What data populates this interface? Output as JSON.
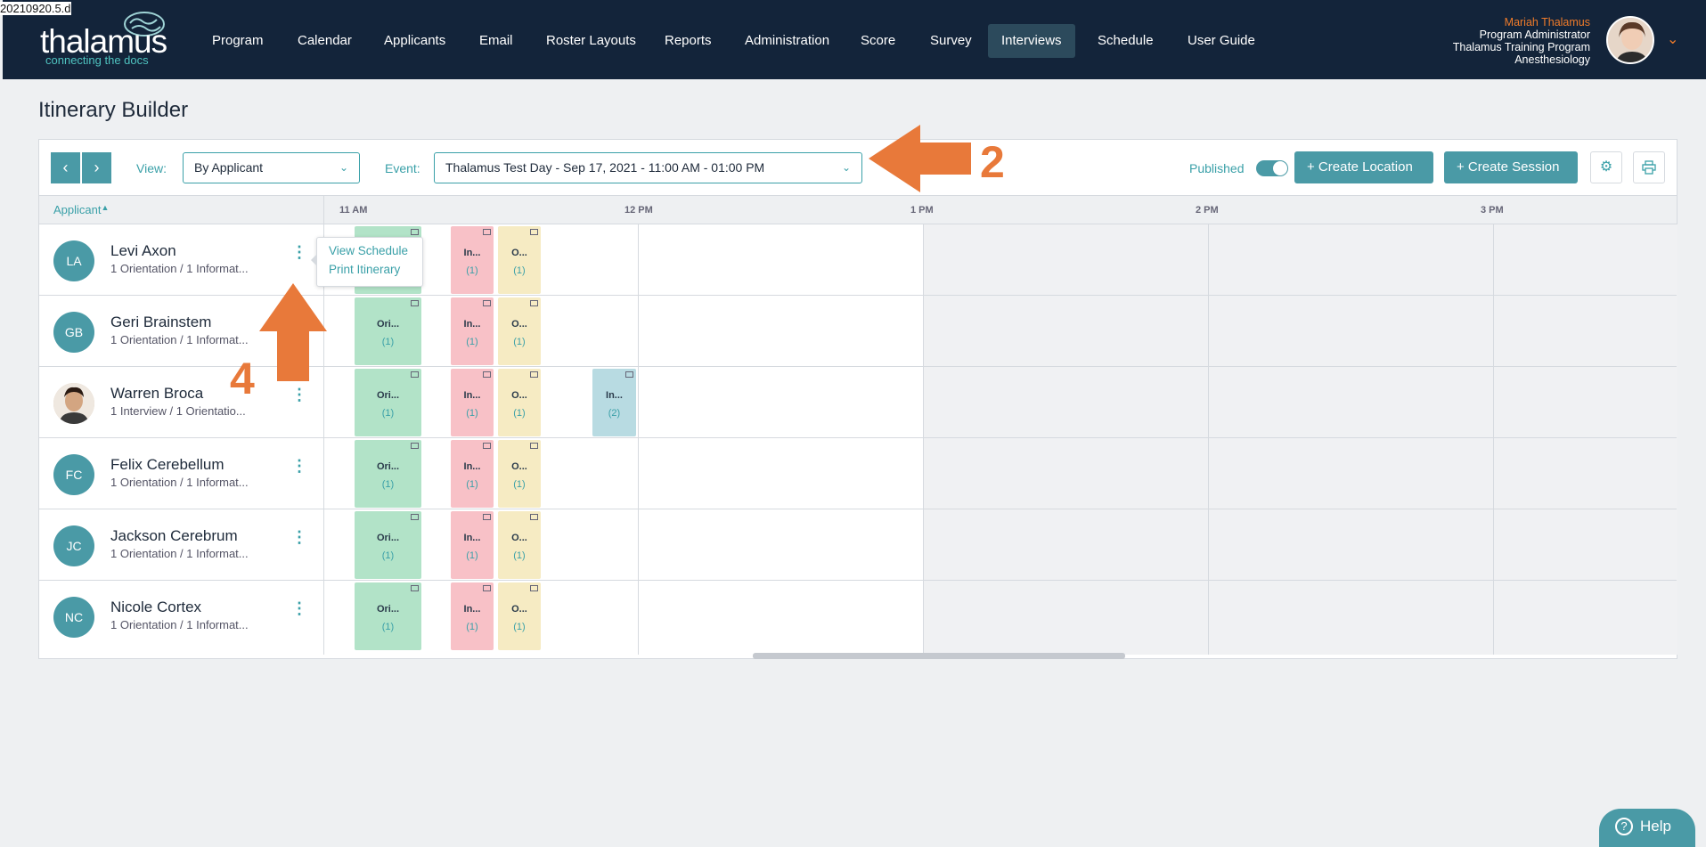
{
  "version": "20210920.5.d",
  "brand": {
    "name": "thalamus",
    "tagline": "connecting the docs"
  },
  "nav": [
    {
      "label": "Program"
    },
    {
      "label": "Calendar"
    },
    {
      "label": "Applicants"
    },
    {
      "label": "Email"
    },
    {
      "label": "Roster Layouts"
    },
    {
      "label": "Reports"
    },
    {
      "label": "Administration"
    },
    {
      "label": "Score"
    },
    {
      "label": "Survey"
    },
    {
      "label": "Interviews",
      "active": true
    },
    {
      "label": "Schedule"
    },
    {
      "label": "User Guide"
    }
  ],
  "user": {
    "name": "Mariah Thalamus",
    "role": "Program Administrator",
    "program": "Thalamus Training Program",
    "specialty": "Anesthesiology"
  },
  "page_title": "Itinerary Builder",
  "toolbar": {
    "view_label": "View:",
    "view_value": "By Applicant",
    "event_label": "Event:",
    "event_value": "Thalamus Test Day - Sep 17, 2021 - 11:00 AM - 01:00 PM",
    "published_label": "Published",
    "published": true,
    "create_location": "+ Create Location",
    "create_session": "+ Create Session"
  },
  "table": {
    "applicant_header": "Applicant",
    "times": [
      "11 AM",
      "12 PM",
      "1 PM",
      "2 PM",
      "3 PM"
    ]
  },
  "applicants": [
    {
      "initials": "LA",
      "name": "Levi Axon",
      "summary": "1 Orientation / 1 Informat...",
      "photo": false
    },
    {
      "initials": "GB",
      "name": "Geri Brainstem",
      "summary": "1 Orientation / 1 Informat...",
      "photo": false
    },
    {
      "initials": "",
      "name": "Warren Broca",
      "summary": "1 Interview / 1 Orientatio...",
      "photo": true
    },
    {
      "initials": "FC",
      "name": "Felix Cerebellum",
      "summary": "1 Orientation / 1 Informat...",
      "photo": false
    },
    {
      "initials": "JC",
      "name": "Jackson Cerebrum",
      "summary": "1 Orientation / 1 Informat...",
      "photo": false
    },
    {
      "initials": "NC",
      "name": "Nicole Cortex",
      "summary": "1 Orientation / 1 Informat...",
      "photo": false
    }
  ],
  "blocks": {
    "orientation": {
      "label": "Ori...",
      "count": "(1)"
    },
    "interview": {
      "label": "In...",
      "count": "(1)"
    },
    "other": {
      "label": "O...",
      "count": "(1)"
    },
    "interview2": {
      "label": "In...",
      "count": "(2)"
    }
  },
  "popup": {
    "view_schedule": "View Schedule",
    "print_itinerary": "Print Itinerary"
  },
  "annotations": {
    "event_step": "2",
    "menu_step": "4"
  },
  "help_label": "Help",
  "colors": {
    "nav_bg": "#13243a",
    "accent": "#4a9aa6",
    "annotation": "#e8793a"
  }
}
